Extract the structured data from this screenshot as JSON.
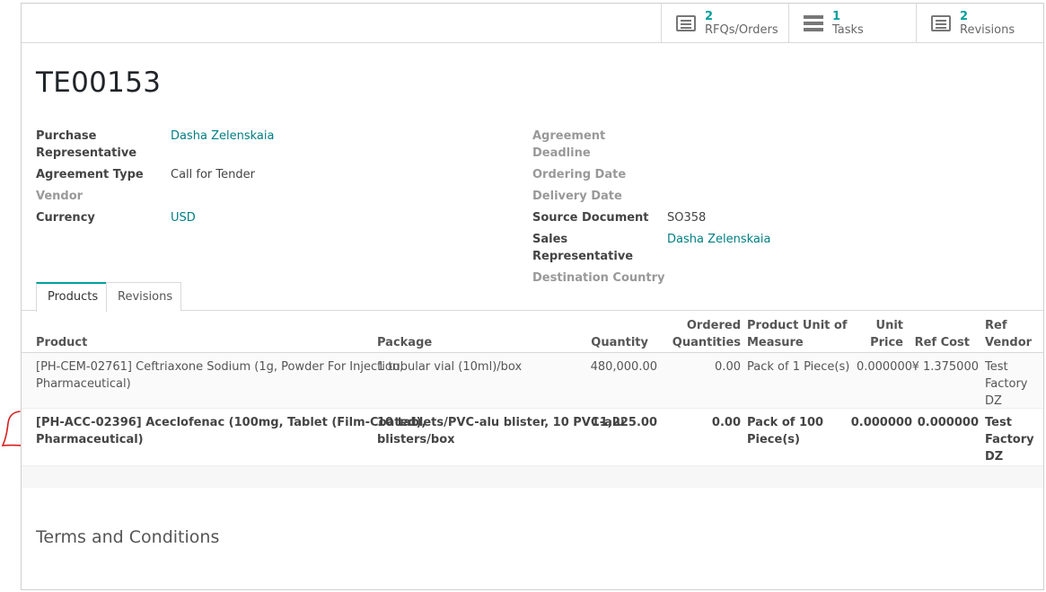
{
  "stat_buttons": [
    {
      "count": "2",
      "label": "RFQs/Orders",
      "icon": "list-icon"
    },
    {
      "count": "1",
      "label": "Tasks",
      "icon": "tasks-icon"
    },
    {
      "count": "2",
      "label": "Revisions",
      "icon": "list-icon"
    }
  ],
  "record": {
    "title": "TE00153"
  },
  "left_fields": {
    "purchase_rep_label_1": "Purchase",
    "purchase_rep_label_2": "Representative",
    "purchase_rep_value": "Dasha Zelenskaia",
    "agreement_type_label": "Agreement Type",
    "agreement_type_value": "Call for Tender",
    "vendor_label": "Vendor",
    "currency_label": "Currency",
    "currency_value": "USD"
  },
  "right_fields": {
    "agreement_deadline_label": "Agreement Deadline",
    "ordering_date_label": "Ordering Date",
    "delivery_date_label": "Delivery Date",
    "source_document_label": "Source Document",
    "source_document_value": "SO358",
    "sales_rep_label": "Sales Representative",
    "sales_rep_value": "Dasha Zelenskaia",
    "destination_country_label": "Destination Country"
  },
  "tabs": [
    "Products",
    "Revisions"
  ],
  "table": {
    "headers": {
      "product": "Product",
      "package": "Package",
      "quantity": "Quantity",
      "ordered_1": "Ordered",
      "ordered_2": "Quantities",
      "uom_1": "Product Unit of",
      "uom_2": "Measure",
      "unit_price_1": "Unit",
      "unit_price_2": "Price",
      "ref_cost": "Ref Cost",
      "ref_vendor_1": "Ref",
      "ref_vendor_2": "Vendor"
    },
    "rows": [
      {
        "product_1": "[PH-CEM-02761] Ceftriaxone Sodium (1g, Powder For Injection,",
        "product_2": "Pharmaceutical)",
        "package_1": "1 tubular vial (10ml)/box",
        "package_2": "",
        "quantity": "480,000.00",
        "ordered": "0.00",
        "uom_1": "Pack of 1 Piece(s)",
        "uom_2": "",
        "unit_price": "0.000000",
        "ref_cost": "¥ 1.375000",
        "vendor_1": "Test",
        "vendor_2": "Factory",
        "vendor_3": "DZ"
      },
      {
        "product_1": "[PH-ACC-02396] Aceclofenac (100mg, Tablet (Film-Coated),",
        "product_2": "Pharmaceutical)",
        "package_1": "10 tablets/PVC-alu blister, 10 PVC-alu",
        "package_2": "blisters/box",
        "quantity": "11,225.00",
        "ordered": "0.00",
        "uom_1": "Pack of 100",
        "uom_2": "Piece(s)",
        "unit_price": "0.000000",
        "ref_cost": "0.000000",
        "vendor_1": "Test",
        "vendor_2": "Factory",
        "vendor_3": "DZ"
      }
    ]
  },
  "terms_title": "Terms and Conditions",
  "colors": {
    "accent": "#00a09d",
    "link": "#017e84",
    "annotation": "#d61f1f"
  }
}
